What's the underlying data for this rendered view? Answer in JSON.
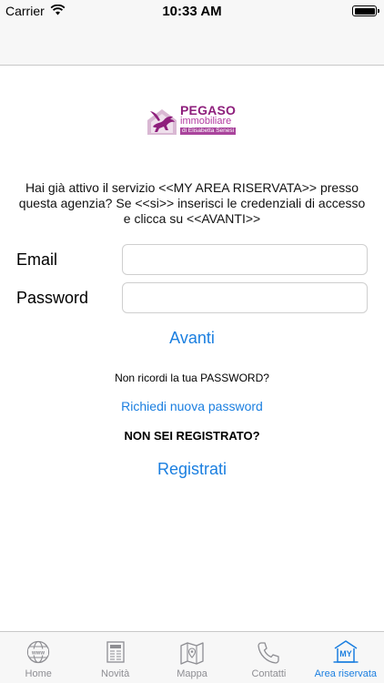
{
  "status_bar": {
    "carrier": "Carrier",
    "time": "10:33 AM"
  },
  "logo": {
    "line1": "PEGASO",
    "line2": "immobiliare",
    "line3": "di Elisabetta Senesi"
  },
  "intro_text": "Hai già attivo il servizio <<MY AREA RISERVATA>> presso questa agenzia? Se <<si>> inserisci le credenziali di accesso e clicca su <<AVANTI>>",
  "form": {
    "email_label": "Email",
    "email_value": "",
    "password_label": "Password",
    "password_value": "",
    "submit_label": "Avanti"
  },
  "forgot": {
    "question": "Non ricordi la tua PASSWORD?",
    "link": "Richiedi nuova password"
  },
  "register": {
    "question": "NON SEI REGISTRATO?",
    "link": "Registrati"
  },
  "tabs": [
    {
      "label": "Home",
      "icon": "globe-icon"
    },
    {
      "label": "Novità",
      "icon": "newspaper-icon"
    },
    {
      "label": "Mappa",
      "icon": "map-icon"
    },
    {
      "label": "Contatti",
      "icon": "phone-icon"
    },
    {
      "label": "Area riservata",
      "icon": "my-house-icon",
      "badge": "MY",
      "active": true
    }
  ],
  "colors": {
    "accent": "#1b7fe0",
    "brand": "#8e1f7c",
    "tab_inactive": "#8e8e93"
  }
}
